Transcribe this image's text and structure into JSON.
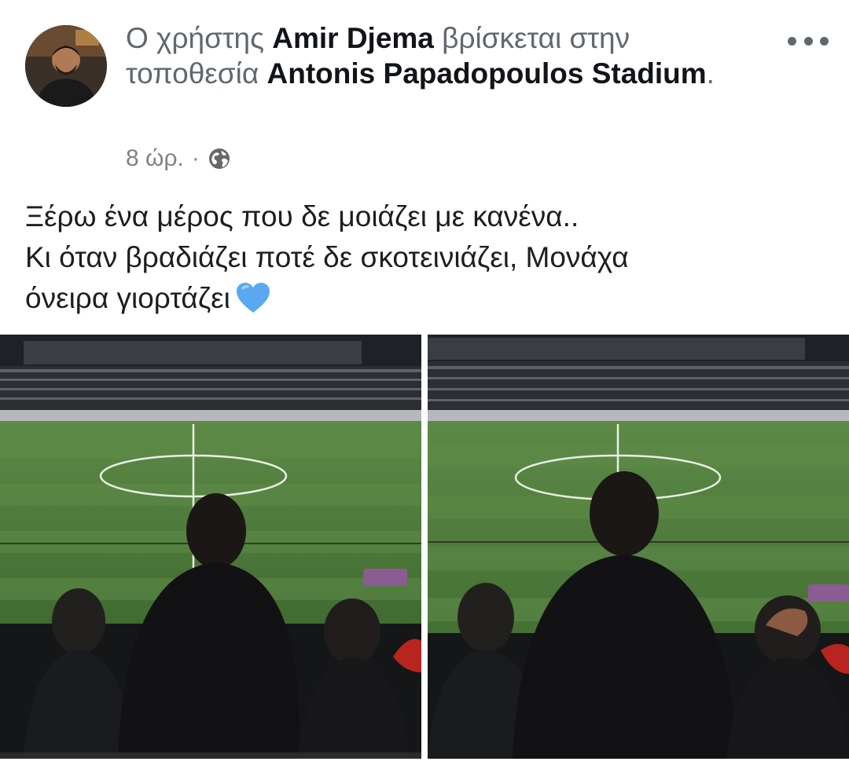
{
  "post": {
    "author_prefix": "Ο χρήστης",
    "author_name": "Amir Djema",
    "location_prefix": "βρίσκεται στην τοποθεσία",
    "location_name": "Antonis Papadopoulos Stadium",
    "location_suffix": ".",
    "time": "8 ώρ.",
    "separator": "·",
    "privacy_icon": "globe-icon",
    "more_icon": "ellipsis-icon",
    "text_lines": [
      "Ξέρω ένα μέρος που δε μοιάζει με κανένα..",
      "Κι όταν βραδιάζει ποτέ δε σκοτεινιάζει, Μονάχα",
      "όνειρα γιορτάζει"
    ],
    "emoji": "blue-heart-icon"
  },
  "photos": [
    {
      "name": "stadium-photo-1",
      "subject": "man with two children watching football pitch from stands"
    },
    {
      "name": "stadium-photo-2",
      "subject": "man with two children watching football pitch from stands, closer view"
    }
  ],
  "colors": {
    "name_text": "#111418",
    "secondary_text": "#606770",
    "heart": "#5aa9f0",
    "pitch": "#4f7a3e"
  }
}
